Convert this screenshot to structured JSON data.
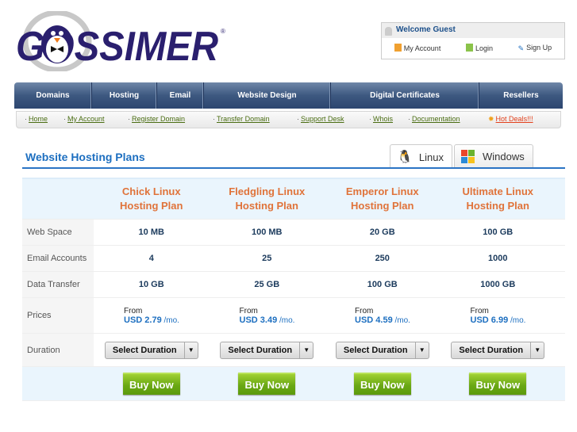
{
  "brand": {
    "name": "GOSSIMER"
  },
  "welcome": {
    "title": "Welcome Guest",
    "links": [
      "My Account",
      "Login",
      "Sign Up"
    ]
  },
  "nav": [
    "Domains",
    "Hosting",
    "Email",
    "Website Design",
    "Digital Certificates",
    "Resellers"
  ],
  "subnav": [
    "Home",
    "My Account",
    "Register Domain",
    "Transfer Domain",
    "Support Desk",
    "Whois",
    "Documentation",
    "Hot Deals!!!"
  ],
  "section_title": "Website Hosting Plans",
  "tabs": [
    "Linux",
    "Windows"
  ],
  "table": {
    "plans": [
      "Chick Linux Hosting Plan",
      "Fledgling Linux Hosting Plan",
      "Emperor Linux Hosting Plan",
      "Ultimate Linux Hosting Plan"
    ],
    "rows": [
      {
        "label": "Web Space",
        "values": [
          "10 MB",
          "100 MB",
          "20 GB",
          "100 GB"
        ]
      },
      {
        "label": "Email Accounts",
        "values": [
          "4",
          "25",
          "250",
          "1000"
        ]
      },
      {
        "label": "Data Transfer",
        "values": [
          "10 GB",
          "25 GB",
          "100 GB",
          "1000 GB"
        ]
      }
    ],
    "prices_label": "Prices",
    "from": "From",
    "prices": [
      "USD 2.79",
      "USD 3.49",
      "USD 4.59",
      "USD 6.99"
    ],
    "per": "/mo.",
    "duration_label": "Duration",
    "select": "Select Duration",
    "buy": "Buy Now"
  },
  "colors": {
    "nav": "#3d5880",
    "accent": "#1d6fc0",
    "plan": "#e0733a",
    "buy": "#6aa814"
  }
}
